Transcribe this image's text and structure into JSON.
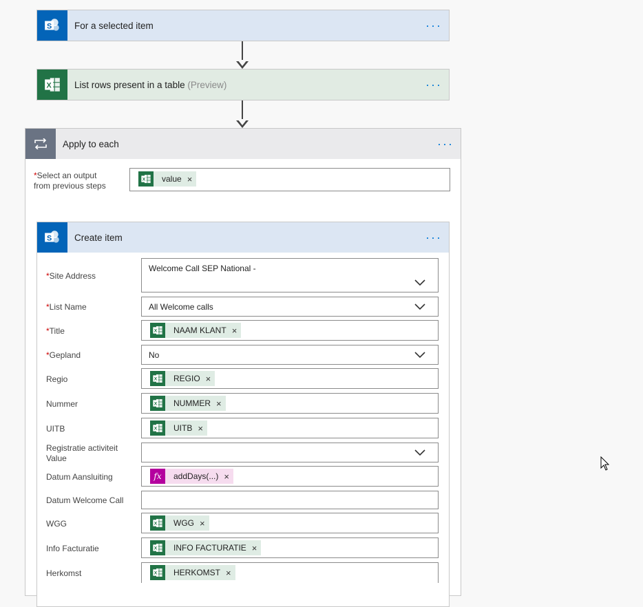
{
  "steps": {
    "trigger": {
      "title": "For a selected item",
      "more": "···"
    },
    "list_rows": {
      "title": "List rows present in a table",
      "preview": "(Preview)",
      "more": "···"
    }
  },
  "apply_each": {
    "title": "Apply to each",
    "more": "···",
    "select_label_line1": "Select an output",
    "select_label_line2": "from previous steps",
    "required_mark": "*",
    "select_token": "value"
  },
  "create_item": {
    "title": "Create item",
    "more": "···",
    "fields": {
      "site_address": {
        "label": "Site Address",
        "value": "Welcome Call SEP National -"
      },
      "list_name": {
        "label": "List Name",
        "value": "All Welcome calls"
      },
      "title": {
        "label": "Title",
        "token": "NAAM KLANT"
      },
      "gepland": {
        "label": "Gepland",
        "value": "No"
      },
      "regio": {
        "label": "Regio",
        "token": "REGIO"
      },
      "nummer": {
        "label": "Nummer",
        "token": "NUMMER"
      },
      "uitb": {
        "label": "UITB",
        "token": "UITB"
      },
      "registratie": {
        "label_line1": "Registratie activiteit",
        "label_line2": "Value"
      },
      "datum_aansluiting": {
        "label": "Datum Aansluiting",
        "token": "addDays(...)",
        "token_icon": "fx"
      },
      "datum_welcome": {
        "label": "Datum Welcome Call"
      },
      "wgg": {
        "label": "WGG",
        "token": "WGG"
      },
      "info_facturatie": {
        "label": "Info Facturatie",
        "token": "INFO FACTURATIE"
      },
      "herkomst": {
        "label": "Herkomst",
        "token": "HERKOMST"
      }
    }
  },
  "icons": {
    "sharepoint": "sharepoint-icon",
    "excel": "excel-icon",
    "loop": "loop-icon",
    "expression": "fx-icon",
    "remove": "×"
  },
  "colors": {
    "sharepoint": "#0364b8",
    "excel": "#217346",
    "expression": "#b4009e",
    "link": "#0078d7",
    "required": "#c00000"
  }
}
